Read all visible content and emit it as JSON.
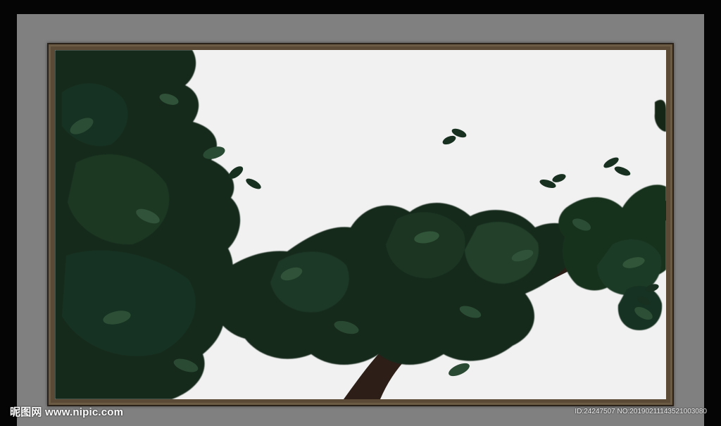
{
  "watermark": {
    "brand": "昵图网",
    "site": "www.nipic.com",
    "id_text": "ID:24247507 NO:20190211143521003080"
  },
  "colors": {
    "outer_background": "#050505",
    "mat": "#808080",
    "frame": "#5a4a36",
    "painting_background": "#f1f1f1",
    "foliage_dark": "#12241a",
    "foliage_mid": "#1f3a28",
    "foliage_light": "#2f5238",
    "trunk": "#2d1f18"
  },
  "image": {
    "subject": "dark green tree branch with dense foliage",
    "icon": "tree-branch-artwork"
  }
}
